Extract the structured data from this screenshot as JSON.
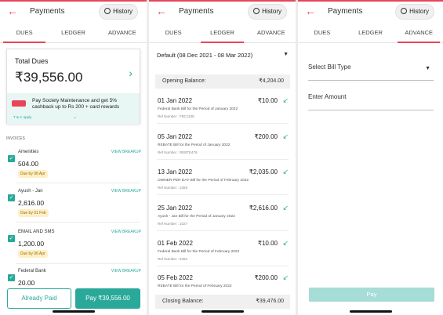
{
  "header": {
    "title": "Payments",
    "history_label": "History"
  },
  "tabs": [
    "DUES",
    "LEDGER",
    "ADVANCE"
  ],
  "dues": {
    "total_label": "Total Dues",
    "total_amount": "₹39,556.00",
    "promo_text": "Pay Society Maintenance and get 5% cashback up to Rs 200 + card rewards",
    "promo_tc": "T & C apply",
    "invoices_label": "INVOICES",
    "view_breakup_label": "VIEW BREAKUP",
    "bills": [
      {
        "name": "Amenities",
        "amount": "504.00",
        "due": "Due by 08 Apr"
      },
      {
        "name": "Ayush - Jan",
        "amount": "2,616.00",
        "due": "Due by 01 Feb"
      },
      {
        "name": "EMAIL AND SMS",
        "amount": "1,200.00",
        "due": "Due by 06 Apr"
      },
      {
        "name": "Federal Bank",
        "amount": "20.00",
        "due": ""
      }
    ],
    "already_paid_label": "Already Paid",
    "pay_label": "Pay ₹39,556.00"
  },
  "ledger": {
    "range": "Default (08 Dec 2021 - 08 Mar 2022)",
    "opening_label": "Opening Balance:",
    "opening_amount": "₹4,204.00",
    "closing_label": "Closing Balance:",
    "closing_amount": "₹39,476.00",
    "transactions": [
      {
        "date": "01 Jan 2022",
        "amount": "₹10.00",
        "desc": "Federal Bank Bill for the Period of January 2022",
        "ref": "Ref Number : FBC1108"
      },
      {
        "date": "05 Jan 2022",
        "amount": "₹200.00",
        "desc": "REBATE Bill for the Period of January 2022",
        "ref": "Ref Number : REBTE478"
      },
      {
        "date": "13 Jan 2022",
        "amount": "₹2,035.00",
        "desc": "OWNER PER DAY Bill for the Period of February 2022",
        "ref": "Ref Number : 2359"
      },
      {
        "date": "25 Jan 2022",
        "amount": "₹2,616.00",
        "desc": "Ayush - Jan Bill for the Period of January 2022",
        "ref": "Ref Number : 1027"
      },
      {
        "date": "01 Feb 2022",
        "amount": "₹10.00",
        "desc": "Federal Bank Bill for the Period of February 2022",
        "ref": "Ref Number : 8462"
      },
      {
        "date": "05 Feb 2022",
        "amount": "₹200.00",
        "desc": "REBATE Bill for the Period of February 2022",
        "ref": ""
      }
    ]
  },
  "advance": {
    "bill_type_placeholder": "Select Bill Type",
    "amount_placeholder": "Enter Amount",
    "pay_label": "Pay"
  },
  "icons": {
    "back": "back-arrow-icon",
    "history": "clock-icon",
    "chevron": "chevron-right-icon",
    "dropdown": "caret-down-icon",
    "txn": "arrow-down-left-icon",
    "check": "checkbox-checked-icon"
  },
  "colors": {
    "accent": "#e8455a",
    "primary": "#2aa99a",
    "primary_disabled": "#a6ddd6"
  }
}
